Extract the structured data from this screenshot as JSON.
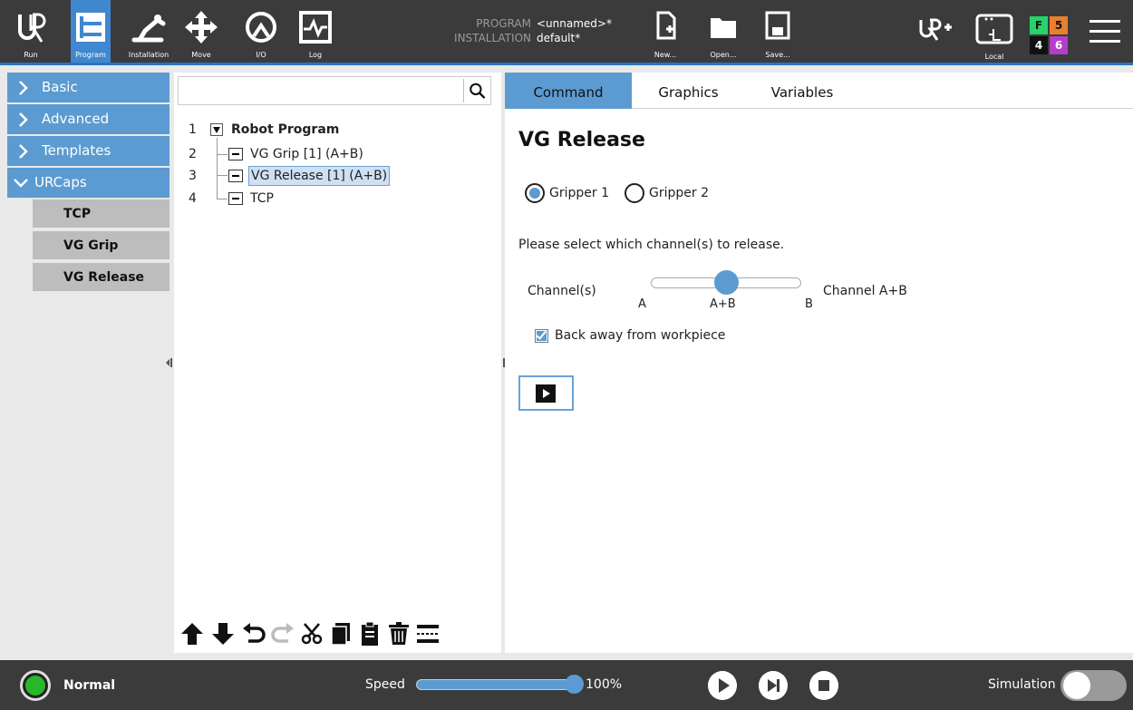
{
  "nav": {
    "run": "Run",
    "program": "Program",
    "installation": "Installation",
    "move": "Move",
    "io": "I/O",
    "log": "Log"
  },
  "program_info": {
    "program_key": "PROGRAM",
    "program_value": "<unnamed>*",
    "installation_key": "INSTALLATION",
    "installation_value": "default*"
  },
  "file": {
    "new": "New...",
    "open": "Open...",
    "save": "Save..."
  },
  "local_label": "Local",
  "status": {
    "f": "F",
    "five": "5",
    "four": "4",
    "six": "6",
    "colors": {
      "f_bg": "#25d36a",
      "five_bg": "#e8802c",
      "four_bg": "#111111",
      "six_bg": "#b43ec9"
    }
  },
  "sidebar": {
    "categories": [
      "Basic",
      "Advanced",
      "Templates",
      "URCaps"
    ],
    "urcaps_items": [
      "TCP",
      "VG Grip",
      "VG Release"
    ]
  },
  "tree": {
    "rows": [
      {
        "num": "1",
        "label": "Robot Program"
      },
      {
        "num": "2",
        "label": "VG Grip [1] (A+B)"
      },
      {
        "num": "3",
        "label": "VG Release [1] (A+B)"
      },
      {
        "num": "4",
        "label": "TCP"
      }
    ]
  },
  "tabs": [
    "Command",
    "Graphics",
    "Variables"
  ],
  "command": {
    "title": "VG Release",
    "gripper1": "Gripper 1",
    "gripper2": "Gripper 2",
    "prompt": "Please select which channel(s) to release.",
    "channels_label": "Channel(s)",
    "tick_a": "A",
    "tick_ab": "A+B",
    "tick_b": "B",
    "channel_value": "Channel A+B",
    "channel_position": 0.5,
    "back_away": "Back away from workpiece",
    "back_away_checked": true
  },
  "bottom": {
    "mode": "Normal",
    "speed_label": "Speed",
    "speed_value": "100%",
    "speed_fraction": 1.0,
    "simulation": "Simulation"
  },
  "colors": {
    "accent": "#5b9bd1",
    "bar": "#3b3b3b",
    "nav_active": "#3f88d0"
  }
}
